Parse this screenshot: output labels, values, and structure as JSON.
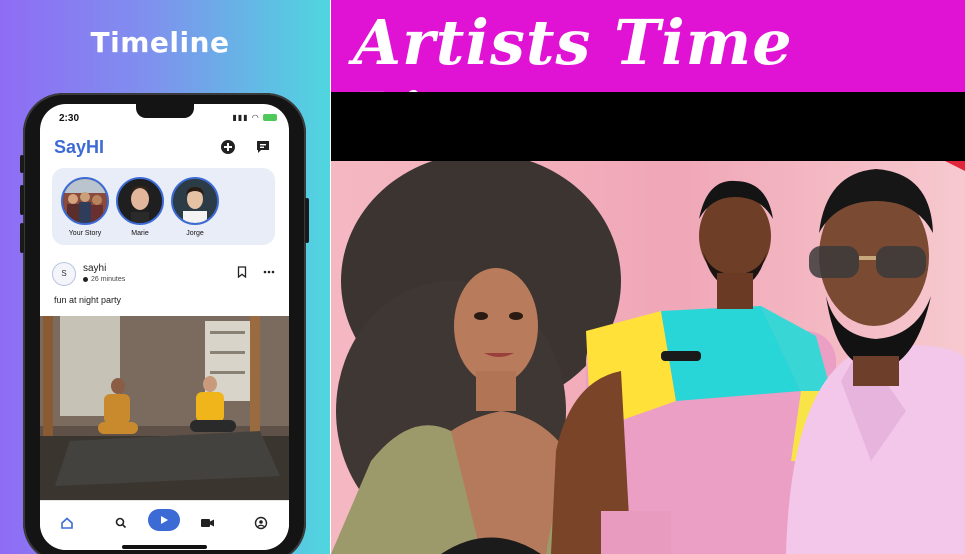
{
  "left_title": "Timeline",
  "phone": {
    "status_time": "2:30",
    "app_title": "SayHI",
    "stories": [
      {
        "label": "Your Story"
      },
      {
        "label": "Marie"
      },
      {
        "label": "Jorge"
      }
    ],
    "post": {
      "avatar_letter": "S",
      "user": "sayhi",
      "time": "26 minutes",
      "text": "fun at night party"
    },
    "nav": [
      "home-icon",
      "search-icon",
      "play-icon",
      "video-icon",
      "profile-icon"
    ]
  },
  "banner": {
    "title": "Artists Time Line"
  },
  "colors": {
    "accent_blue": "#3d6bd6",
    "banner_magenta": "#e012d4"
  }
}
